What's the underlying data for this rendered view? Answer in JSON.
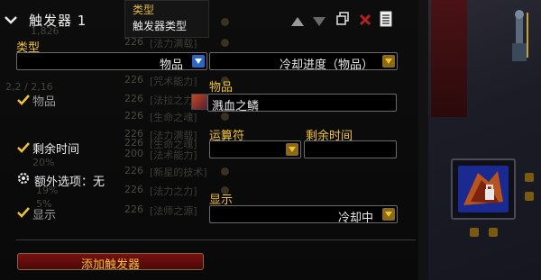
{
  "header": {
    "title": "触发器 1",
    "tooltip_title": "类型",
    "tooltip_desc": "触发器类型"
  },
  "background_list": {
    "left": [
      "1,826",
      "2,2 / 2,16",
      "20%",
      "19%",
      "5%"
    ],
    "rows": [
      {
        "num": "226",
        "text": "[生命之魂]"
      },
      {
        "num": "226",
        "text": "[法力满载]"
      },
      {
        "num": "226",
        "text": "[法杖]"
      },
      {
        "num": "226",
        "text": "[咒术能力]"
      },
      {
        "num": "226",
        "text": "[法拉之力]"
      },
      {
        "num": "226",
        "text": "[生命之魂]"
      },
      {
        "num": "226",
        "text": "[法力满载]"
      },
      {
        "num": "226",
        "text": "[生命之魂]"
      },
      {
        "num": "200",
        "text": "[法术能力]"
      },
      {
        "num": "226",
        "text": "[新星的技术]"
      },
      {
        "num": "226",
        "text": "[法力之力]"
      },
      {
        "num": "226",
        "text": "[法师之源]"
      }
    ]
  },
  "type_section": {
    "label": "类型",
    "category_value": "物品",
    "trigger_value": "冷却进度（物品）"
  },
  "item_section": {
    "checkbox_label": "物品",
    "field_label": "物品",
    "item_name": "溅血之鳞"
  },
  "remaining_section": {
    "checkbox_label": "剩余时间",
    "operator_label": "运算符",
    "operator_value": "",
    "remaining_label": "剩余时间",
    "remaining_value": ""
  },
  "extra_options": {
    "label": "额外选项：无"
  },
  "show_section": {
    "checkbox_label": "显示",
    "field_label": "显示",
    "value": "冷却中"
  },
  "add_trigger": {
    "label": "添加触发器"
  },
  "colors": {
    "gold": "#f1c232",
    "dropdown_blue": "#2a66c8",
    "close_red": "#b82020",
    "add_button_red": "#7a1010"
  }
}
